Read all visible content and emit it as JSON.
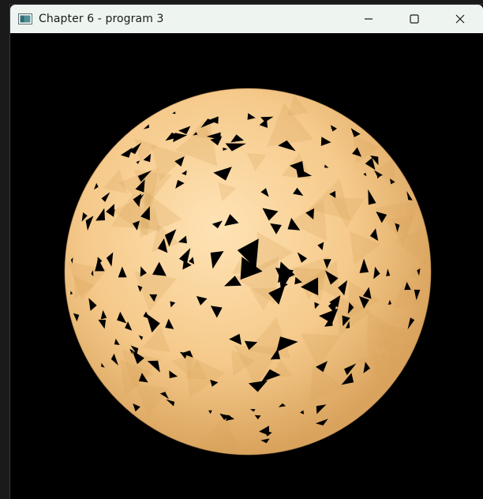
{
  "window": {
    "title": "Chapter 6 - program 3"
  },
  "controls": {
    "minimize_icon": "minimize-icon",
    "maximize_icon": "maximize-icon",
    "close_icon": "close-icon"
  },
  "scene": {
    "background": "#000000",
    "sphere_color": "#f5c98a",
    "sphere_shade": "#d9a35d",
    "hole_color": "#000000"
  }
}
